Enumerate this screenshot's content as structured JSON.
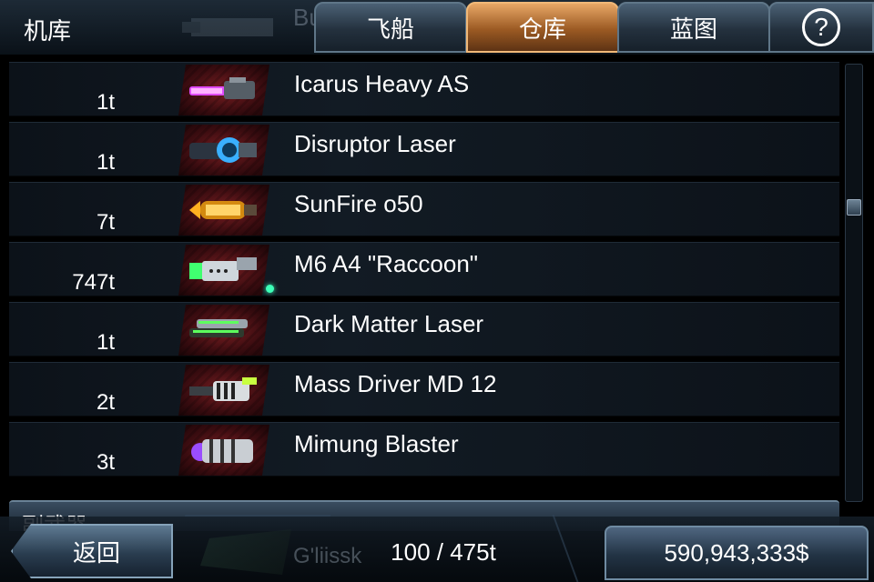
{
  "header": {
    "title": "机库",
    "ghost_label": "Bu",
    "tabs": [
      {
        "label": "飞船",
        "active": false
      },
      {
        "label": "仓库",
        "active": true
      },
      {
        "label": "蓝图",
        "active": false
      }
    ],
    "help_label": "?"
  },
  "items": [
    {
      "name": "Icarus Heavy AS",
      "qty": "1t",
      "icon": "magenta-cannon-icon",
      "accent": "#e04bff"
    },
    {
      "name": "Disruptor Laser",
      "qty": "1t",
      "icon": "blue-laser-icon",
      "accent": "#3ab0ff"
    },
    {
      "name": "SunFire o50",
      "qty": "7t",
      "icon": "orange-blaster-icon",
      "accent": "#ffb020"
    },
    {
      "name": "M6 A4 \"Raccoon\"",
      "qty": "747t",
      "icon": "green-gun-icon",
      "accent": "#40ff70"
    },
    {
      "name": "Dark Matter Laser",
      "qty": "1t",
      "icon": "green-laser-icon",
      "accent": "#5dff5d"
    },
    {
      "name": "Mass Driver MD 12",
      "qty": "2t",
      "icon": "mass-driver-icon",
      "accent": "#c8ff40"
    },
    {
      "name": "Mimung Blaster",
      "qty": "3t",
      "icon": "purple-blaster-icon",
      "accent": "#9a4dff"
    }
  ],
  "section_header": "副武器",
  "footer": {
    "back_label": "返回",
    "ghost_label": "G'liissk",
    "capacity": "100 / 475t",
    "money": "590,943,333$"
  }
}
